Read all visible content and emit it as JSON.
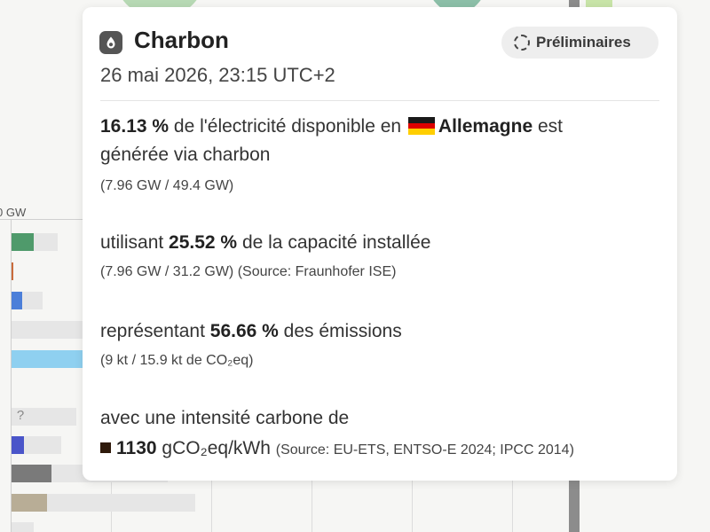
{
  "background": {
    "axis_tick": "0 GW",
    "unknown_marker": "?"
  },
  "tooltip": {
    "icon": "coal-icon",
    "title": "Charbon",
    "datetime": "26 mai 2026, 23:15 UTC+2",
    "badge": "Préliminaires",
    "share": {
      "value": "16.13 %",
      "text_before_country": "de l'électricité disponible en",
      "country": "Allemagne",
      "text_after_country": "est",
      "text_line2": "générée via charbon",
      "detail": "(7.96 GW / 49.4 GW)"
    },
    "capacity": {
      "prefix": "utilisant",
      "value": "25.52 %",
      "suffix": "de la capacité installée",
      "detail": "(7.96 GW / 31.2 GW) (Source: Fraunhofer ISE)"
    },
    "emissions": {
      "prefix": "représentant",
      "value": "56.66 %",
      "suffix": "des émissions",
      "detail": "(9 kt / 15.9 kt de CO₂eq)"
    },
    "intensity": {
      "label": "avec une intensité carbone de",
      "value": "1130",
      "unit": "gCO₂eq/kWh",
      "source": "(Source: EU-ETS, ENTSO-E 2024; IPCC 2014)"
    }
  },
  "colors": {
    "flag_black": "#1a1a1a",
    "flag_red": "#dd0000",
    "flag_gold": "#ffce00",
    "coal_swatch": "#2f1a0b"
  }
}
